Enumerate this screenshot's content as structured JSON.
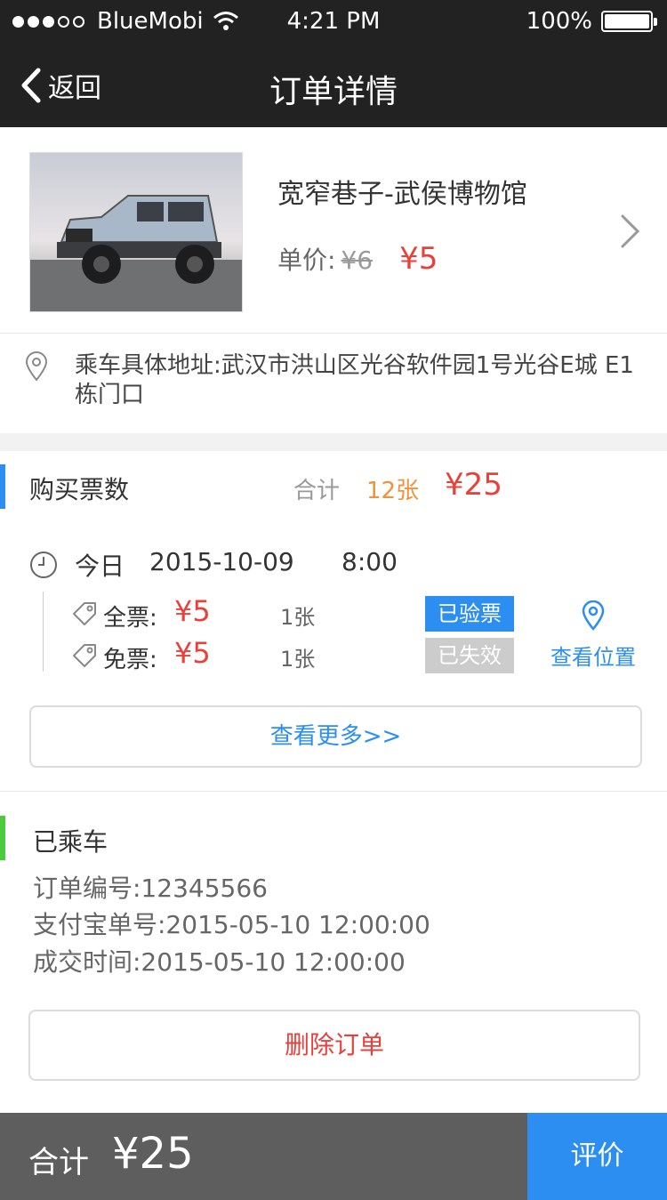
{
  "status_bar": {
    "carrier": "BlueMobi",
    "time": "4:21 PM",
    "battery": "100%"
  },
  "nav": {
    "back_label": "返回",
    "title": "订单详情"
  },
  "product": {
    "name": "宽窄巷子-武侯博物馆",
    "price_label": "单价:",
    "original_price": "¥6",
    "price": "¥5"
  },
  "address": {
    "text": "乘车具体地址:武汉市洪山区光谷软件园1号光谷E城 E1栋门口"
  },
  "tickets": {
    "title": "购买票数",
    "total_label": "合计",
    "total_count": "12张",
    "total_price": "¥25",
    "day": "今日",
    "date": "2015-10-09",
    "time": "8:00",
    "rows": [
      {
        "label": "全票:",
        "price": "¥5",
        "count": "1张",
        "status": "已验票"
      },
      {
        "label": "免票:",
        "price": "¥5",
        "count": "1张",
        "status": "已失效"
      }
    ],
    "location_label": "查看位置",
    "more_label": "查看更多>>"
  },
  "order": {
    "status": "已乘车",
    "number_line": "订单编号:12345566",
    "alipay_line": "支付宝单号:2015-05-10  12:00:00",
    "deal_time_line": "成交时间:2015-05-10  12:00:00",
    "delete_label": "删除订单"
  },
  "bottom": {
    "total_label": "合计",
    "total_value": "¥25",
    "rate_label": "评价"
  },
  "colors": {
    "header_bg": "#222222",
    "accent_blue": "#2b8ef0",
    "price_red": "#e8403a",
    "count_orange": "#f0923c",
    "status_green": "#4ccc3c",
    "bottom_bar_bg": "#5e5e5e"
  },
  "icons": {
    "back": "chevron-left-icon",
    "wifi": "wifi-icon",
    "product_arrow": "chevron-right-icon",
    "address": "map-pin-icon",
    "time": "clock-icon",
    "ticket": "tag-icon",
    "location": "location-pin-icon"
  }
}
